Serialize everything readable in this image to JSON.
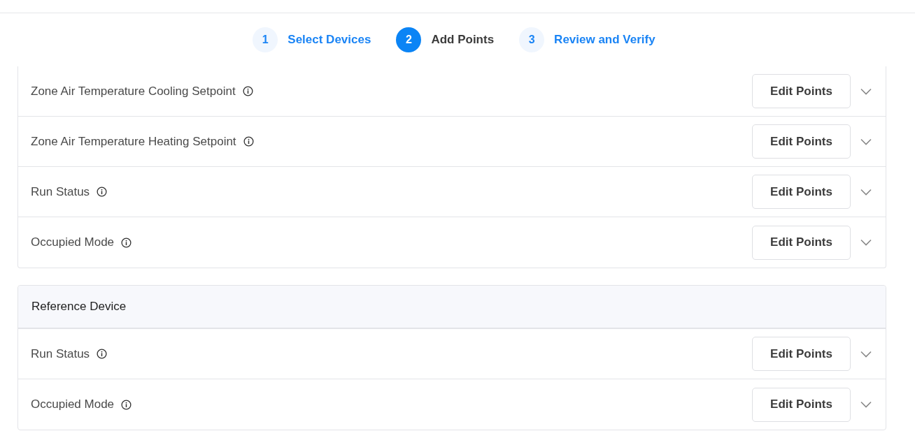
{
  "steps": [
    {
      "number": "1",
      "label": "Select Devices",
      "selected": false
    },
    {
      "number": "2",
      "label": "Add Points",
      "selected": true
    },
    {
      "number": "3",
      "label": "Review and Verify",
      "selected": false
    }
  ],
  "sections": [
    {
      "rows": [
        {
          "label": "Zone Air Temperature Cooling Setpoint",
          "button": "Edit Points",
          "expanded": false
        },
        {
          "label": "Zone Air Temperature Heating Setpoint",
          "button": "Edit Points",
          "expanded": false
        },
        {
          "label": "Run Status",
          "button": "Edit Points",
          "expanded": false
        },
        {
          "label": "Occupied Mode",
          "button": "Edit Points",
          "expanded": false
        }
      ]
    },
    {
      "header": "Reference Device",
      "rows": [
        {
          "label": "Run Status",
          "button": "Edit Points",
          "expanded": false
        },
        {
          "label": "Occupied Mode",
          "button": "Edit Points",
          "expanded": false
        }
      ]
    }
  ]
}
